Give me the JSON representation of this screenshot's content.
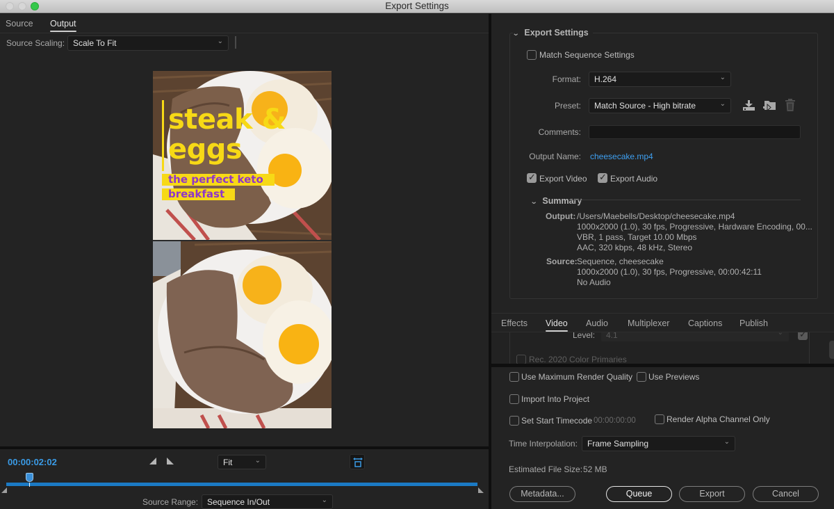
{
  "window": {
    "title": "Export Settings"
  },
  "left_panel": {
    "tabs": [
      {
        "label": "Source",
        "active": false
      },
      {
        "label": "Output",
        "active": true
      }
    ],
    "source_scaling_label": "Source Scaling:",
    "source_scaling_value": "Scale To Fit",
    "preview": {
      "headline_line1": "steak &",
      "headline_line2": "eggs",
      "subline1": "the perfect keto",
      "subline2": "breakfast",
      "headline_color": "#f7d916",
      "subline_color": "#8e36c9"
    },
    "timeline": {
      "current_timecode": "00:00:02:02",
      "duration_timecode": "00:00:42:11",
      "zoom_value": "Fit",
      "playhead_fraction": 0.048,
      "source_range_label": "Source Range:",
      "source_range_value": "Sequence In/Out"
    }
  },
  "export_settings": {
    "section_title": "Export Settings",
    "match_sequence_label": "Match Sequence Settings",
    "match_sequence_checked": false,
    "format_label": "Format:",
    "format_value": "H.264",
    "preset_label": "Preset:",
    "preset_value": "Match Source - High bitrate",
    "comments_label": "Comments:",
    "comments_value": "",
    "output_name_label": "Output Name:",
    "output_name_value": "cheesecake.mp4",
    "export_video_label": "Export Video",
    "export_video_checked": true,
    "export_audio_label": "Export Audio",
    "export_audio_checked": true,
    "summary_title": "Summary",
    "summary_output_key": "Output:",
    "summary_output_lines": [
      "/Users/Maebells/Desktop/cheesecake.mp4",
      "1000x2000 (1.0), 30 fps, Progressive, Hardware Encoding, 00...",
      "VBR, 1 pass, Target 10.00 Mbps",
      "AAC, 320 kbps, 48 kHz, Stereo"
    ],
    "summary_source_key": "Source:",
    "summary_source_lines": [
      "Sequence, cheesecake",
      "1000x2000 (1.0), 30 fps, Progressive, 00:00:42:11",
      "No Audio"
    ]
  },
  "settings_tabs": [
    {
      "label": "Effects",
      "active": false
    },
    {
      "label": "Video",
      "active": true
    },
    {
      "label": "Audio",
      "active": false
    },
    {
      "label": "Multiplexer",
      "active": false
    },
    {
      "label": "Captions",
      "active": false
    },
    {
      "label": "Publish",
      "active": false
    }
  ],
  "video_tab": {
    "level_label": "Level:",
    "level_value": "4.1",
    "rec2020_label": "Rec. 2020 Color Primaries"
  },
  "render_options": {
    "max_render_quality_label": "Use Maximum Render Quality",
    "use_previews_label": "Use Previews",
    "import_into_project_label": "Import Into Project",
    "set_start_timecode_label": "Set Start Timecode",
    "start_timecode_value": "00:00:00:00",
    "render_alpha_label": "Render Alpha Channel Only",
    "time_interpolation_label": "Time Interpolation:",
    "time_interpolation_value": "Frame Sampling",
    "estimated_size_label": "Estimated File Size:",
    "estimated_size_value": "52 MB"
  },
  "buttons": {
    "metadata": "Metadata...",
    "queue": "Queue",
    "export": "Export",
    "cancel": "Cancel"
  },
  "colors": {
    "accent_blue": "#3a9be6",
    "link_blue": "#3e9ff0",
    "traffic_green": "#34c84a"
  }
}
